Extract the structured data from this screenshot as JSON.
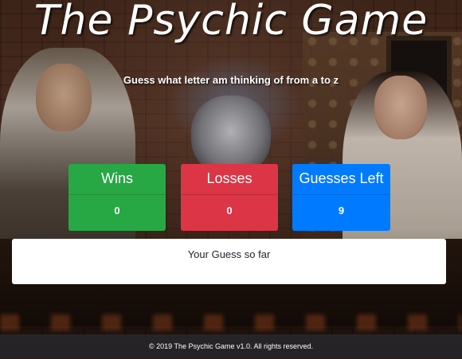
{
  "header": {
    "title": "The Psychic Game",
    "subtitle": "Guess what letter am thinking of from a to z"
  },
  "stats": {
    "wins": {
      "label": "Wins",
      "value": "0"
    },
    "losses": {
      "label": "Losses",
      "value": "0"
    },
    "guesses_left": {
      "label": "Guesses Left",
      "value": "9"
    }
  },
  "guess": {
    "label": "Your Guess so far",
    "value": ""
  },
  "footer": {
    "text": "© 2019 The Psychic Game v1.0. All rights reserved."
  },
  "colors": {
    "wins": "#28a745",
    "losses": "#dc3545",
    "guesses_left": "#007bff"
  }
}
